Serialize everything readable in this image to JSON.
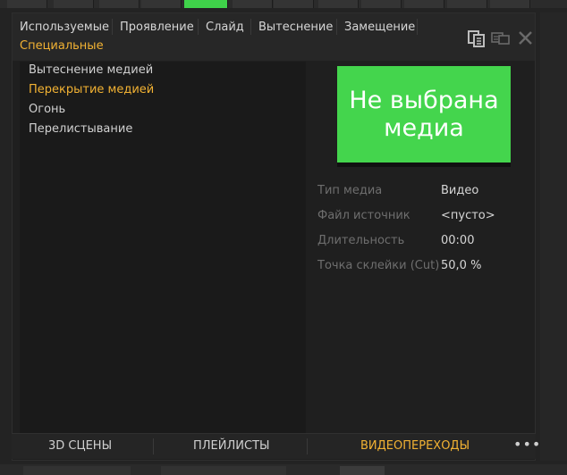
{
  "category_tabs": [
    {
      "label": "Используемые"
    },
    {
      "label": "Проявление"
    },
    {
      "label": "Слайд"
    },
    {
      "label": "Вытеснение"
    },
    {
      "label": "Замещение"
    },
    {
      "label": "Специальные",
      "active": true
    }
  ],
  "header_icons": [
    "copy-icon",
    "sync-icon",
    "close-icon"
  ],
  "effects": [
    {
      "label": "Вытеснение медией"
    },
    {
      "label": "Перекрытие медией",
      "selected": true
    },
    {
      "label": "Огонь"
    },
    {
      "label": "Перелистывание"
    }
  ],
  "preview": {
    "line1": "Не выбрана",
    "line2": "медиа",
    "color": "#44d54d"
  },
  "properties": [
    {
      "label": "Тип медиа",
      "value": "Видео"
    },
    {
      "label": "Файл источник",
      "value": "<пусто>"
    },
    {
      "label": "Длительность",
      "value": "00:00"
    },
    {
      "label": "Точка склейки (Cut)",
      "value": "50,0 %"
    }
  ],
  "bottom_tabs": [
    {
      "label": "3D СЦЕНЫ"
    },
    {
      "label": "ПЛЕЙЛИСТЫ"
    },
    {
      "label": "ВИДЕОПЕРЕХОДЫ",
      "active": true
    }
  ],
  "more_label": "•••",
  "colors": {
    "accent": "#f2b233",
    "background": "#1f1f1f",
    "green": "#3fd24a"
  }
}
